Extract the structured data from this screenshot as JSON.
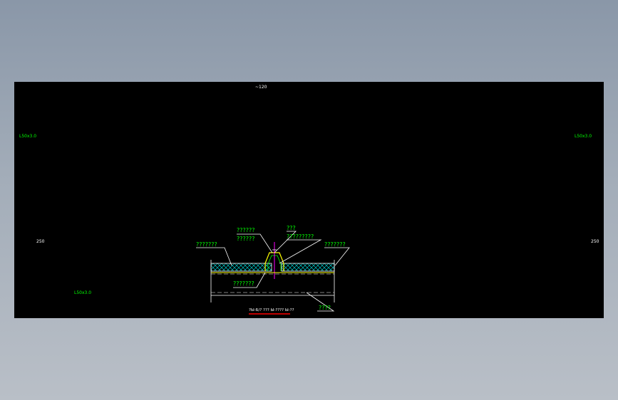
{
  "drawing": {
    "top_dim": "~120",
    "left_dim": "250",
    "right_dim": "250",
    "section_tl": "L50x3.0",
    "section_tr": "L50x3.0",
    "section_bl": "L50x3.0",
    "callouts": {
      "upper_left_1": "??????",
      "upper_left_2": "??????",
      "upper_mid": "???",
      "upper_right": "?????????",
      "left": "???????",
      "right": "???????",
      "bottom_left": "???????",
      "bottom_right": "????"
    },
    "caption": "?Ы-Б/? ??? Ы-???? Ы-??",
    "colors": {
      "background": "#000000",
      "label": "#00ff00",
      "dim_text": "#ffffff",
      "insulation": "#00c8c8",
      "cap": "#ffff00",
      "axis": "#ff00ff",
      "caption_underline": "#ff0000"
    }
  }
}
